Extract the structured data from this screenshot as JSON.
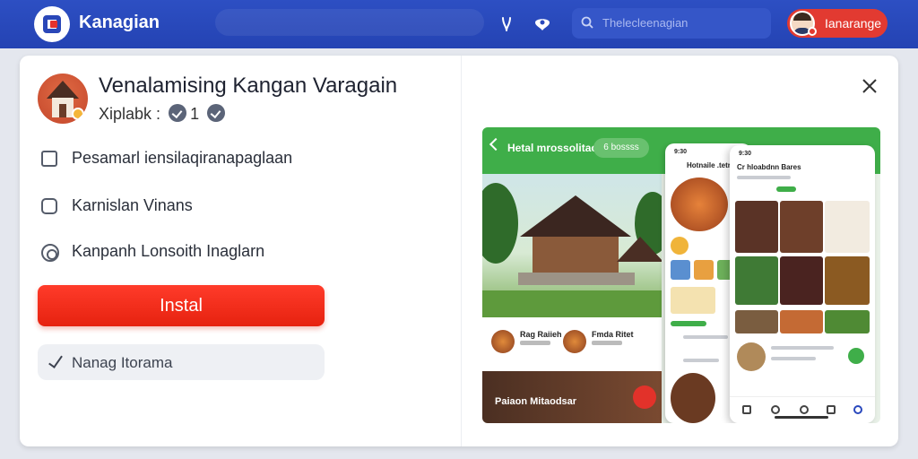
{
  "topbar": {
    "brand_name": "Kanagian",
    "search_placeholder": "Thelecleenagian",
    "profile_name": "Ianarange",
    "icons": [
      "pin-icon",
      "chat-icon",
      "search-icon"
    ]
  },
  "dialog": {
    "app_title": "Venalamising Kangan Varagain",
    "meta_label": "Xiplabk :",
    "meta_count": "1",
    "options": [
      {
        "label": "Pesamarl iensilaqiranapaglaan",
        "type": "checkbox"
      },
      {
        "label": "Karnislan Vinans",
        "type": "checkbox"
      },
      {
        "label": "Kanpanh Lonsoith Inaglarn",
        "type": "radio"
      }
    ],
    "install_label": "Instal",
    "secondary_label": "Nanag Itorama"
  },
  "preview": {
    "header_title": "Hetal mrossolitao",
    "header_chip": "6 bossss",
    "food_items": [
      "Rag Raiieh",
      "Fmda Ritet"
    ],
    "banner_text": "Paiaon Mitaodsar",
    "phone1_title": "Hotnaile .tetr",
    "phone2_title": "Cr hloabdnn Bares",
    "time": "9:30"
  },
  "colors": {
    "topbar": "#2a49bd",
    "accent_red": "#ef2d1c",
    "preview_green": "#3fae49"
  }
}
